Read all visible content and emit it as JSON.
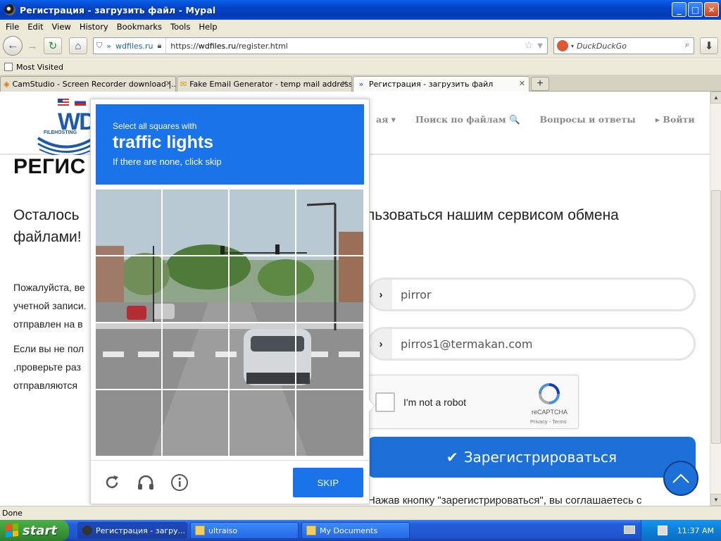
{
  "window": {
    "title": "Регистрация - загрузить файл - Mypal",
    "minimize": "_",
    "maximize": "□",
    "close": "✕"
  },
  "menu": [
    "File",
    "Edit",
    "View",
    "History",
    "Bookmarks",
    "Tools",
    "Help"
  ],
  "nav": {
    "site_identity": "wdfiles.ru",
    "url_prefix": "https://",
    "url_host": "wdfiles.ru",
    "url_path": "/register.html",
    "search_placeholder": "DuckDuckGo"
  },
  "bookmarks": {
    "most_visited": "Most Visited"
  },
  "tabs": [
    {
      "label": "CamStudio - Screen Recorder download |...",
      "close": "✕"
    },
    {
      "label": "Fake Email Generator - temp mail address",
      "close": "✕"
    },
    {
      "label": "Регистрация - загрузить файл",
      "close": "✕"
    }
  ],
  "new_tab": "+",
  "site": {
    "logo_text": "WD",
    "logo_sub": "FILEHOSTING",
    "nav_partial": "ая ▾",
    "nav_search": "Поиск по файлам 🔍",
    "nav_faq": "Вопросы и ответы",
    "nav_login": "▸ Войти"
  },
  "page": {
    "title": "РЕГИС",
    "lead_line1_left": "Осталось",
    "lead_line1_right": "льзоваться нашим сервисом обмена",
    "lead_line2": "файлами!",
    "para1": [
      "Пожалуйста, ве",
      "учетной записи.",
      "отправлен на в"
    ],
    "para2": [
      "Если вы не пол",
      ",проверьте раз",
      "отправляются"
    ],
    "username_value": "pirror",
    "email_value": "pirros1@termakan.com",
    "field_arrow": "›",
    "recaptcha_label": "I'm not a robot",
    "recaptcha_brand": "reCAPTCHA",
    "recaptcha_links": "Privacy - Terms",
    "register_check": "✔",
    "register_label": "Зарегистрироваться",
    "agree_text": "Нажав кнопку \"зарегистрироваться\", вы соглашаетесь с"
  },
  "challenge": {
    "line1": "Select all squares with",
    "line2": "traffic lights",
    "line3": "If there are none, click skip",
    "skip_label": "SKIP",
    "colors": {
      "header": "#1a73e8",
      "button": "#1a73e8"
    }
  },
  "status": {
    "text": "Done"
  },
  "taskbar": {
    "start": "start",
    "tasks": [
      {
        "label": "Регистрация - загру..."
      },
      {
        "label": "ultraiso"
      },
      {
        "label": "My Documents"
      }
    ],
    "clock": "11:37 AM"
  },
  "colors": {
    "accent": "#1c70d7",
    "titlebar": "#0443c6",
    "chrome": "#ece9d8"
  }
}
